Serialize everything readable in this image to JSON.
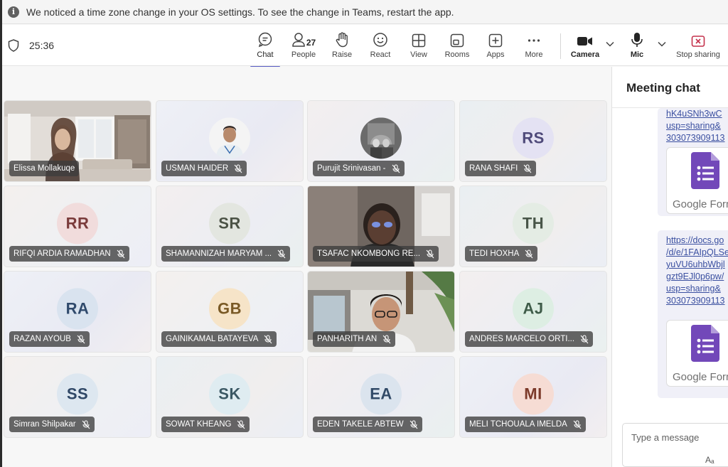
{
  "notice": {
    "text": "We noticed a time zone change in your OS settings. To see the change in Teams, restart the app."
  },
  "toolbar": {
    "timer": "25:36",
    "chat": "Chat",
    "people": "People",
    "people_count": "27",
    "raise": "Raise",
    "react": "React",
    "view": "View",
    "rooms": "Rooms",
    "apps": "Apps",
    "more": "More",
    "camera": "Camera",
    "mic": "Mic",
    "stop_sharing": "Stop sharing"
  },
  "participants": [
    {
      "name": "Elissa Mollakuqe"
    },
    {
      "name": "USMAN HAIDER"
    },
    {
      "name": "Purujit Srinivasan -"
    },
    {
      "name": "RANA SHAFI",
      "initials": "RS"
    },
    {
      "name": "RIFQI ARDIA RAMADHAN",
      "initials": "RR"
    },
    {
      "name": "SHAMANNIZAH MARYAM ...",
      "initials": "SR"
    },
    {
      "name": "TSAFAC NKOMBONG RE..."
    },
    {
      "name": "TEDI HOXHA",
      "initials": "TH"
    },
    {
      "name": "RAZAN AYOUB",
      "initials": "RA"
    },
    {
      "name": "GAINIKAMAL BATAYEVA",
      "initials": "GB"
    },
    {
      "name": "PANHARITH AN"
    },
    {
      "name": "ANDRES MARCELO ORTI...",
      "initials": "AJ"
    },
    {
      "name": "Simran Shilpakar",
      "initials": "SS"
    },
    {
      "name": "SOWAT KHEANG",
      "initials": "SK"
    },
    {
      "name": "EDEN TAKELE ABTEW",
      "initials": "EA"
    },
    {
      "name": "MELI TCHOUALA IMELDA",
      "initials": "MI"
    }
  ],
  "chat": {
    "title": "Meeting chat",
    "msg1_lines": [
      "hK4uSNh3wC",
      "usp=sharing&",
      "303073909113"
    ],
    "msg2_lines": [
      "https://docs.go",
      "/d/e/1FAIpQLSe",
      "yuVU6uhbWbjl",
      "gzt9EJl0p6pw/",
      "usp=sharing&",
      "303073909113"
    ],
    "card_label": "Google Form",
    "composer_placeholder": "Type a message",
    "format_label": "Aₐ"
  },
  "colors": {
    "accent": "#5b5fc7",
    "stop_sharing": "#c4314b",
    "google_forms": "#7248b9"
  }
}
